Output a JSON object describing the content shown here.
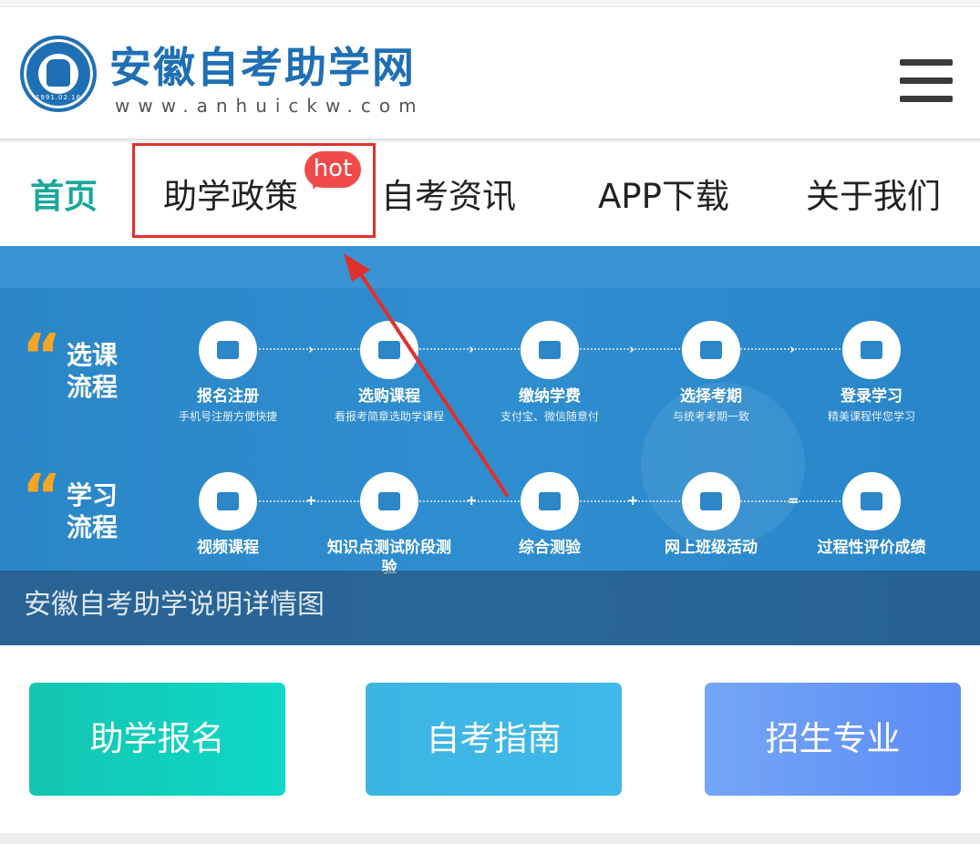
{
  "header": {
    "title": "安徽自考助学网",
    "url": "www.anhuickw.com",
    "logo_date": "1991.02.16"
  },
  "nav": {
    "items": [
      {
        "label": "首页",
        "active": true
      },
      {
        "label": "助学政策",
        "active": false,
        "badge": "hot"
      },
      {
        "label": "自考资讯",
        "active": false
      },
      {
        "label": "APP下载",
        "active": false
      },
      {
        "label": "关于我们",
        "active": false
      }
    ]
  },
  "banner": {
    "quote_mark": "“",
    "course_flow": {
      "title": "选课流程",
      "steps": [
        {
          "name": "报名注册",
          "desc": "手机号注册方便快捷"
        },
        {
          "name": "选购课程",
          "desc": "看报考简章选助学课程"
        },
        {
          "name": "缴纳学费",
          "desc": "支付宝、微信随意付"
        },
        {
          "name": "选择考期",
          "desc": "与统考考期一致"
        },
        {
          "name": "登录学习",
          "desc": "精美课程伴您学习"
        }
      ]
    },
    "study_flow": {
      "title": "学习流程",
      "steps": [
        {
          "name": "视频课程"
        },
        {
          "name": "知识点测试阶段测验"
        },
        {
          "name": "综合测验"
        },
        {
          "name": "网上班级活动"
        },
        {
          "name": "过程性评价成绩"
        }
      ],
      "connectors": [
        "+",
        "+",
        "+",
        "="
      ]
    },
    "caption": "安徽自考助学说明详情图"
  },
  "actions": [
    {
      "label": "助学报名"
    },
    {
      "label": "自考指南"
    },
    {
      "label": "招生专业"
    }
  ],
  "colors": {
    "brand": "#1f6fb5",
    "nav_active": "#1aa79b",
    "highlight": "#e0302b",
    "hot_badge": "#f04b4b",
    "quote": "#f5a623"
  }
}
